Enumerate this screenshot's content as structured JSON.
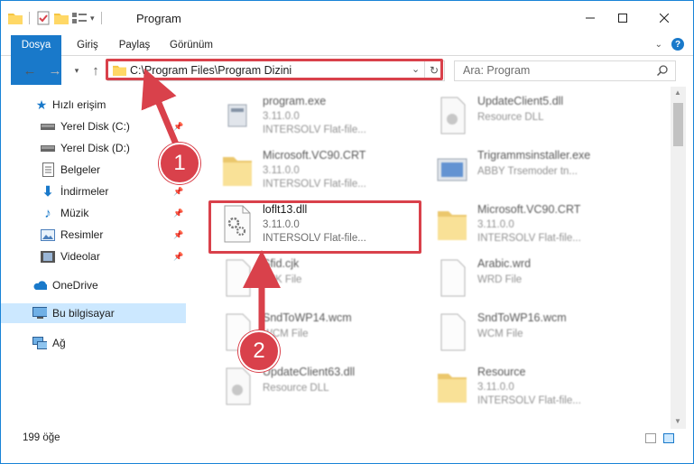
{
  "titlebar": {
    "title": "Program"
  },
  "ribbon": {
    "tabs": [
      "Dosya",
      "Giriş",
      "Paylaş",
      "Görünüm"
    ]
  },
  "address": {
    "path": "C:\\Program Files\\Program Dizini"
  },
  "search": {
    "placeholder": "Ara: Program"
  },
  "sidebar": {
    "items": [
      {
        "label": "Hızlı erişim",
        "icon": "star-icon"
      },
      {
        "label": "Yerel Disk (C:)",
        "icon": "drive-icon"
      },
      {
        "label": "Yerel Disk (D:)",
        "icon": "drive-icon"
      },
      {
        "label": "Belgeler",
        "icon": "documents-icon"
      },
      {
        "label": "İndirmeler",
        "icon": "download-icon"
      },
      {
        "label": "Müzik",
        "icon": "music-icon"
      },
      {
        "label": "Resimler",
        "icon": "pictures-icon"
      },
      {
        "label": "Videolar",
        "icon": "video-icon"
      },
      {
        "label": "OneDrive",
        "icon": "cloud-icon"
      },
      {
        "label": "Bu bilgisayar",
        "icon": "computer-icon"
      },
      {
        "label": "Ağ",
        "icon": "network-icon"
      }
    ]
  },
  "files": [
    {
      "name": "program.exe",
      "version": "3.11.0.0",
      "desc": "INTERSOLV Flat-file...",
      "icon": "exe-icon"
    },
    {
      "name": "UpdateClient5.dll",
      "version": "",
      "desc": "Resource DLL",
      "icon": "dll-icon"
    },
    {
      "name": "Microsoft.VC90.CRT",
      "version": "3.11.0.0",
      "desc": "INTERSOLV Flat-file...",
      "icon": "folder-icon"
    },
    {
      "name": "Trigrammsinstaller.exe",
      "version": "",
      "desc": "ABBY Trsemoder tn...",
      "icon": "installer-icon"
    },
    {
      "name": "loflt13.dll",
      "version": "3.11.0.0",
      "desc": "INTERSOLV Flat-file...",
      "icon": "dll-icon"
    },
    {
      "name": "Microsoft.VC90.CRT",
      "version": "3.11.0.0",
      "desc": "INTERSOLV Flat-file...",
      "icon": "folder-icon"
    },
    {
      "name": "Sfid.cjk",
      "version": "",
      "desc": "CJK File",
      "icon": "file-icon"
    },
    {
      "name": "Arabic.wrd",
      "version": "",
      "desc": "WRD File",
      "icon": "file-icon"
    },
    {
      "name": "SndToWP14.wcm",
      "version": "",
      "desc": "WCM File",
      "icon": "file-icon"
    },
    {
      "name": "SndToWP16.wcm",
      "version": "",
      "desc": "WCM File",
      "icon": "file-icon"
    },
    {
      "name": "UpdateClient63.dll",
      "version": "",
      "desc": "Resource DLL",
      "icon": "dll-icon"
    },
    {
      "name": "Resource",
      "version": "3.11.0.0",
      "desc": "INTERSOLV Flat-file...",
      "icon": "folder-icon"
    }
  ],
  "status": {
    "count": "199 öğe"
  },
  "callouts": [
    "1",
    "2"
  ],
  "colors": {
    "accent": "#1979ca",
    "highlight": "#d9414b",
    "selected": "#cce8ff"
  }
}
